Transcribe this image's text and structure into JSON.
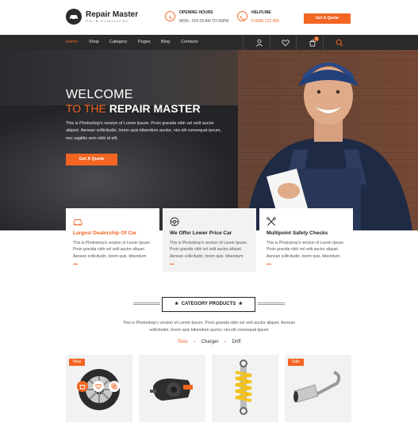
{
  "brand": {
    "name": "Repair Master",
    "tagline": "Car & Accessories"
  },
  "header": {
    "opening": {
      "title": "OPENING HOURS",
      "value": "MON - FRI 09 AM TO 06PM"
    },
    "helpline": {
      "title": "HELPLINE",
      "value": "0 0000 123 456"
    },
    "quote_button": "Get A Quote"
  },
  "nav": {
    "items": [
      "Home",
      "Shop",
      "Category",
      "Pages",
      "Blog",
      "Contacts"
    ],
    "active": "Home",
    "cart_count": "0"
  },
  "hero": {
    "title_line1": "WELCOME",
    "title_line2_prefix": "TO THE",
    "title_line2_highlight": "REPAIR MASTER",
    "text": "This is Photoshop's version of Lorem Ipsum. Proin gravida nibh vel velit auctor aliquet. Aenean sollicitudin, lorem quis bibendum auctor, nisi elit consequat ipsum, nec sagittis sem nibh id elit.",
    "button": "Get A Quote"
  },
  "features": [
    {
      "title": "Largest Dealership Of Car",
      "text": "This is Photoshop's version of Lorem Ipsum. Proin gravida nibh vel velit auctor aliquet. Aenean sollicitudin, lorem quis. bibendum",
      "icon": "car-icon"
    },
    {
      "title": "We Offer Lower Price Car",
      "text": "This is Photoshop's version of Lorem Ipsum. Proin gravida nibh vel velit auctor aliquet. Aenean sollicitudin, lorem quis. bibendum",
      "icon": "steering-wheel-icon"
    },
    {
      "title": "Multipoint Safety Checks",
      "text": "This is Photoshop's version of Lorem Ipsum. Proin gravida nibh vel velit auctor aliquet. Aenean sollicitudin, lorem quis. bibendum",
      "icon": "tools-icon"
    }
  ],
  "category": {
    "heading": "CATEGORY PRODUCTS",
    "description": "This is Photoshop's version of Lorem Ipsum. Proin gravida nibh vel velit auctor aliquet. Aenean sollicitudin, lorem quis bibendum auctor, nisi elit consequat ipsum",
    "tabs": [
      "Tires",
      "Charger",
      "Driff"
    ],
    "active_tab": "Tires"
  },
  "products": [
    {
      "badge": "New",
      "name": "tire-wheel"
    },
    {
      "badge": "",
      "name": "charger"
    },
    {
      "badge": "",
      "name": "shock-absorber"
    },
    {
      "badge": "Sale",
      "name": "exhaust-pipe"
    }
  ],
  "colors": {
    "accent": "#f26522",
    "nav_bg": "#2a2a2a",
    "feature_bg": "#f2f2f2"
  }
}
